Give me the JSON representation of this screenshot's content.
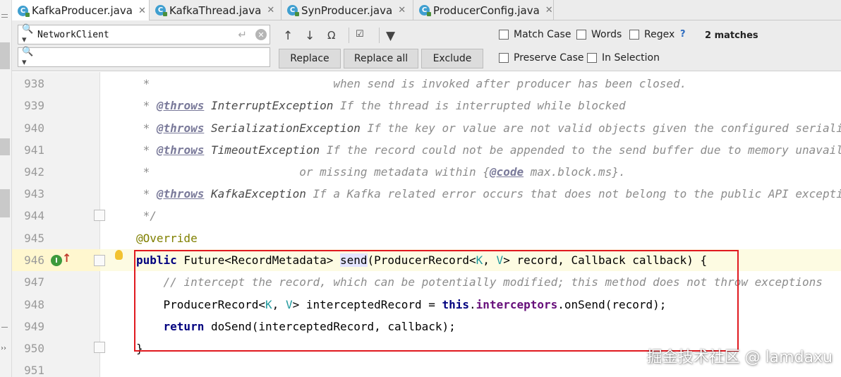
{
  "tabs": [
    {
      "label": "KafkaProducer.java",
      "icon": "java-class-icon",
      "active": true
    },
    {
      "label": "KafkaThread.java",
      "icon": "java-class-icon",
      "active": false
    },
    {
      "label": "SynProducer.java",
      "icon": "java-class-icon",
      "active": false
    },
    {
      "label": "ProducerConfig.java",
      "icon": "java-class-icon",
      "active": false
    }
  ],
  "find": {
    "search_value": "NetworkClient",
    "replace_value": "",
    "replace_label": "Replace",
    "replace_all_label": "Replace all",
    "exclude_label": "Exclude",
    "match_case_label": "Match Case",
    "words_label": "Words",
    "regex_label": "Regex",
    "help_label": "?",
    "preserve_case_label": "Preserve Case",
    "in_selection_label": "In Selection",
    "matches_label": "2 matches"
  },
  "editor": {
    "line_numbers": [
      "938",
      "939",
      "940",
      "941",
      "942",
      "943",
      "944",
      "945",
      "946",
      "947",
      "948",
      "949",
      "950",
      "951"
    ],
    "current_line": "946",
    "code": {
      "l938_a": " * ",
      "l938_b": "                          when send is invoked after producer has been closed.",
      "l939_a": " * ",
      "l939_tag": "@throws",
      "l939_ref": " InterruptException",
      "l939_b": " If the thread is interrupted while blocked",
      "l940_a": " * ",
      "l940_tag": "@throws",
      "l940_ref": " SerializationException",
      "l940_b": " If the key or value are not valid objects given the configured serializers",
      "l941_a": " * ",
      "l941_tag": "@throws",
      "l941_ref": " TimeoutException",
      "l941_b": " If the record could not be appended to the send buffer due to memory unavailable",
      "l942_a": " * ",
      "l942_b": "                     or missing metadata within {",
      "l942_tag": "@code",
      "l942_c": " max.block.ms}.",
      "l943_a": " * ",
      "l943_tag": "@throws",
      "l943_ref": " KafkaException",
      "l943_b": " If a Kafka related error occurs that does not belong to the public API exceptions.",
      "l944": " */",
      "l945": "@Override",
      "l946_kw": "public",
      "l946_a": " Future<RecordMetadata> ",
      "l946_name": "send",
      "l946_b": "(ProducerRecord<",
      "l946_k": "K",
      "l946_c": ", ",
      "l946_v": "V",
      "l946_d": "> record, Callback callback) {",
      "l947": "    // intercept the record, which can be potentially modified; this method does not throw exceptions",
      "l948_a": "    ProducerRecord<",
      "l948_k": "K",
      "l948_b": ", ",
      "l948_v": "V",
      "l948_c": "> interceptedRecord = ",
      "l948_this": "this",
      "l948_d": ".",
      "l948_field": "interceptors",
      "l948_e": ".onSend(record);",
      "l949_kw": "    return",
      "l949_a": " doSend(interceptedRecord, callback);",
      "l950": "}",
      "l951": ""
    }
  },
  "watermark": "掘金技术社区 @ lamdaxu"
}
